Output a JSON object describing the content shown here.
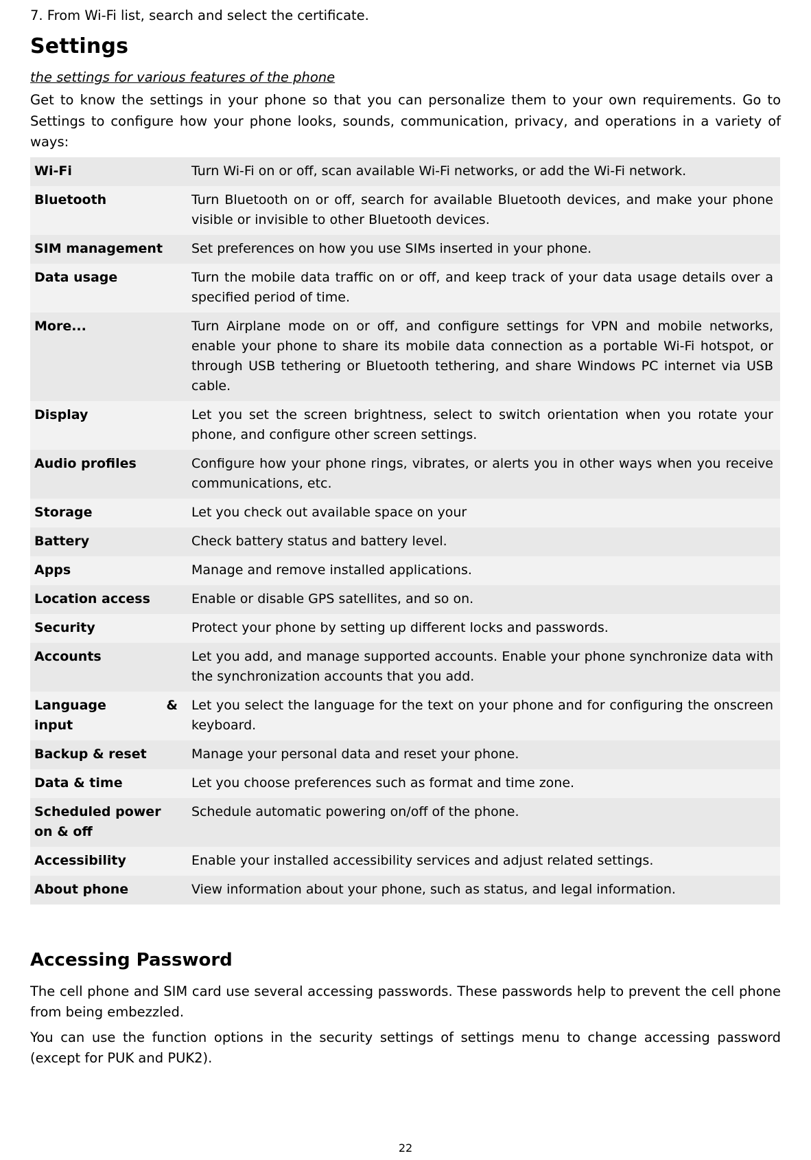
{
  "top_line": "7. From Wi-Fi list, search and select the certificate.",
  "section": {
    "title": "Settings",
    "subtitle": "the settings for various features of the phone",
    "intro": "Get to know the settings in your phone so that you can personalize them to your own requirements. Go to Settings to configure how your phone looks, sounds, communication, privacy, and operations in a variety of ways:"
  },
  "settings_table": {
    "rows": [
      {
        "key": "Wi-Fi",
        "value": "Turn Wi-Fi on or off, scan available Wi-Fi networks, or add the Wi-Fi network."
      },
      {
        "key": "Bluetooth",
        "value": "Turn Bluetooth on or off, search for available Bluetooth devices, and make your phone visible or invisible to other Bluetooth devices."
      },
      {
        "key": "SIM management",
        "value": "Set preferences on how you use SIMs inserted in your phone."
      },
      {
        "key": "Data usage",
        "value": "Turn the mobile data traffic on or off, and keep track of your data usage details over a specified period of time."
      },
      {
        "key": "More...",
        "value": "Turn Airplane mode on or off, and configure settings for VPN and mobile networks, enable your phone to share its mobile data connection as a portable Wi-Fi hotspot, or through USB tethering or Bluetooth tethering, and share Windows PC internet via USB cable."
      },
      {
        "key": "Display",
        "value": "Let you set the screen brightness, select to switch orientation when you rotate your phone, and configure other screen settings."
      },
      {
        "key": "Audio profiles",
        "value": "Configure how your phone rings, vibrates, or alerts you in other ways when you receive communications, etc."
      },
      {
        "key": "Storage",
        "value": "Let you check out available space on your"
      },
      {
        "key": "Battery",
        "value": "Check battery status and battery level."
      },
      {
        "key": "Apps",
        "value": "Manage and remove installed applications."
      },
      {
        "key": "Location access",
        "value": "Enable or disable GPS satellites, and so on."
      },
      {
        "key": "Security",
        "value": "Protect your phone by setting up different locks and passwords."
      },
      {
        "key": "Accounts",
        "value": "Let you add, and manage supported accounts. Enable your phone synchronize data with the synchronization accounts that you add."
      },
      {
        "key": "Language & input",
        "key_left": "Language",
        "key_right": "&",
        "key_second_line": "input",
        "value": "Let you select the language for the text on your phone and for configuring the onscreen keyboard."
      },
      {
        "key": "Backup & reset",
        "value": "Manage your personal data and reset your phone."
      },
      {
        "key": "Data & time",
        "value": "Let you choose preferences such as format and time zone."
      },
      {
        "key": "Scheduled power on & off",
        "value": "Schedule automatic powering on/off of the phone."
      },
      {
        "key": "Accessibility",
        "value": "Enable your installed accessibility services and adjust related settings."
      },
      {
        "key": "About phone",
        "value": "View information about your phone, such as status, and legal information."
      }
    ]
  },
  "password_section": {
    "title": "Accessing Password",
    "para1": "The cell phone and SIM card use several accessing passwords. These passwords help to prevent the cell phone from being embezzled.",
    "para2": "You can use the function options in the security settings of settings menu to change accessing password (except for PUK and PUK2)."
  },
  "footer": {
    "page_number": "22"
  }
}
